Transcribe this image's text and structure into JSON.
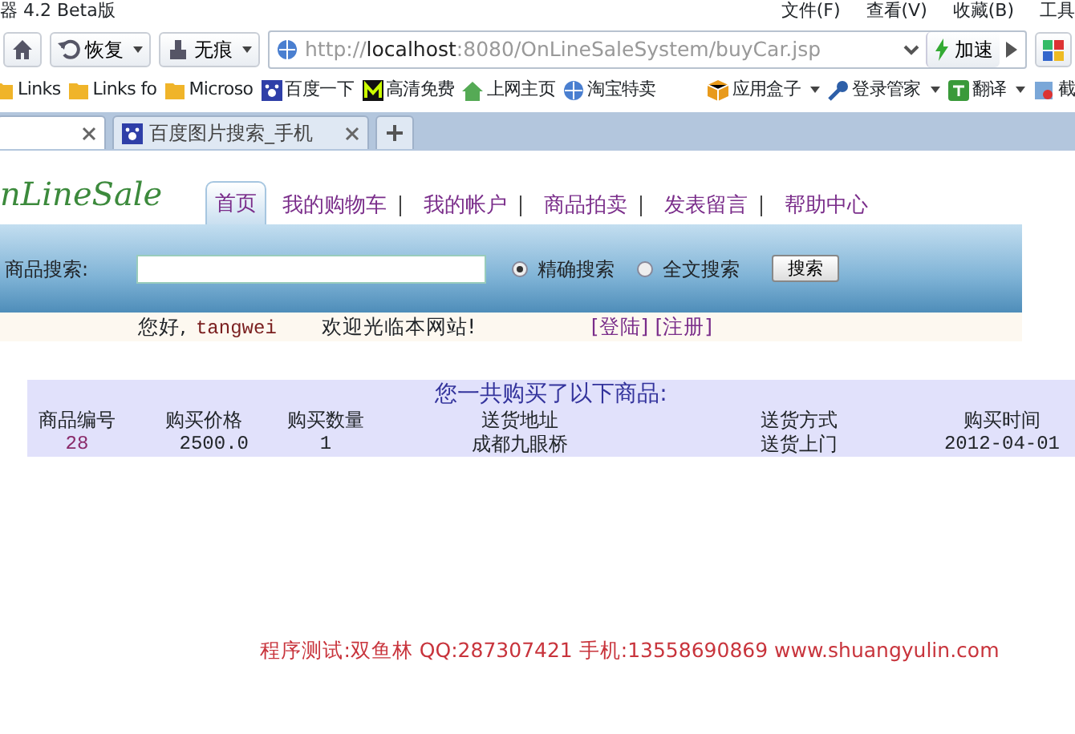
{
  "window": {
    "title": "器 4.2 Beta版",
    "menu": [
      "文件(F)",
      "查看(V)",
      "收藏(B)",
      "工具"
    ]
  },
  "toolbar": {
    "buttons": [
      {
        "label": "恢复",
        "kind": "restore"
      },
      {
        "label": "无痕",
        "kind": "private"
      }
    ],
    "address": "http://localhost:8080/OnLineSaleSystem/buyCar.jsp",
    "speed_label": "加速"
  },
  "bookmarks": [
    {
      "label": "Links",
      "kind": "folder"
    },
    {
      "label": "Links fo",
      "kind": "folder"
    },
    {
      "label": "Microso",
      "kind": "folder"
    },
    {
      "label": "百度一下",
      "kind": "paw"
    },
    {
      "label": "高清免费",
      "kind": "m"
    },
    {
      "label": "上网主页",
      "kind": "home"
    },
    {
      "label": "淘宝特卖",
      "kind": "globe"
    }
  ],
  "bookmark_tools": [
    {
      "label": "应用盒子",
      "kind": "box"
    },
    {
      "label": "登录管家",
      "kind": "key"
    },
    {
      "label": "翻译",
      "kind": "translate"
    },
    {
      "label": "截",
      "kind": "cut"
    }
  ],
  "tabs": [
    {
      "selected": true
    },
    {
      "label": "百度图片搜索_手机",
      "selected": false
    }
  ],
  "page": {
    "logo": "nLineSale",
    "nav": [
      {
        "label": "首页",
        "selected": true
      },
      {
        "label": "我的购物车",
        "selected": false
      },
      {
        "label": "我的帐户",
        "selected": false
      },
      {
        "label": "商品拍卖",
        "selected": false
      },
      {
        "label": "发表留言",
        "selected": false
      },
      {
        "label": "帮助中心",
        "selected": false
      }
    ],
    "search": {
      "label": "商品搜索:",
      "options": [
        {
          "label": "精确搜索",
          "selected": true
        },
        {
          "label": "全文搜索",
          "selected": false
        }
      ],
      "button": "搜索"
    },
    "greeting": {
      "hello": "您好,",
      "user": "tangwei",
      "welcome": "欢迎光临本网站!",
      "links": [
        "[登陆]",
        "[注册]"
      ]
    },
    "table": {
      "caption": "您一共购买了以下商品:",
      "columns": [
        "商品编号",
        "购买价格",
        "购买数量",
        "送货地址",
        "送货方式",
        "购买时间"
      ],
      "rows": [
        [
          "28",
          "2500.0",
          "1",
          "成都九眼桥",
          "送货上门",
          "2012-04-01"
        ]
      ]
    },
    "footer": "程序测试:双鱼林 QQ:287307421 手机:13558690869 www.shuangyulin.com"
  }
}
